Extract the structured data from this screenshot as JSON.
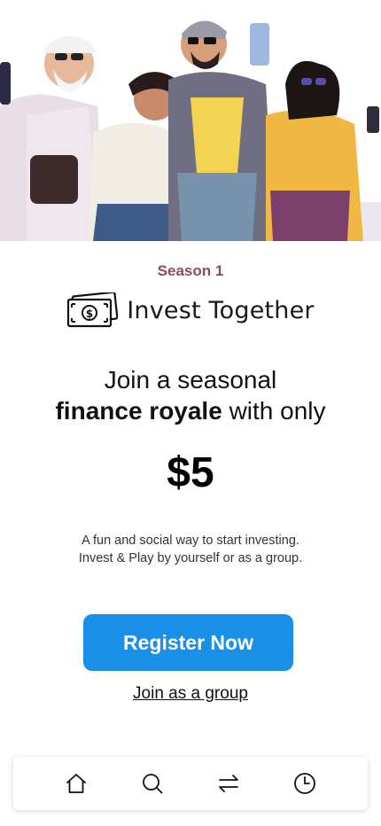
{
  "hero": {
    "illustration": "group-of-people-with-phones"
  },
  "season_label": "Season 1",
  "brand": {
    "icon": "money-bill-icon",
    "name": "Invest Together"
  },
  "headline": {
    "line1": "Join a seasonal",
    "bold": "finance royale",
    "rest": " with only"
  },
  "price": "$5",
  "description": {
    "line1": "A fun and social way to start investing.",
    "line2": "Invest & Play by yourself or as a group."
  },
  "register_button": "Register Now",
  "group_link": "Join as a group",
  "tabbar": {
    "items": [
      {
        "icon": "home-icon"
      },
      {
        "icon": "search-icon"
      },
      {
        "icon": "transfer-icon"
      },
      {
        "icon": "clock-icon"
      }
    ]
  },
  "colors": {
    "accent": "#1a8fe8",
    "season": "#8a4a66"
  }
}
